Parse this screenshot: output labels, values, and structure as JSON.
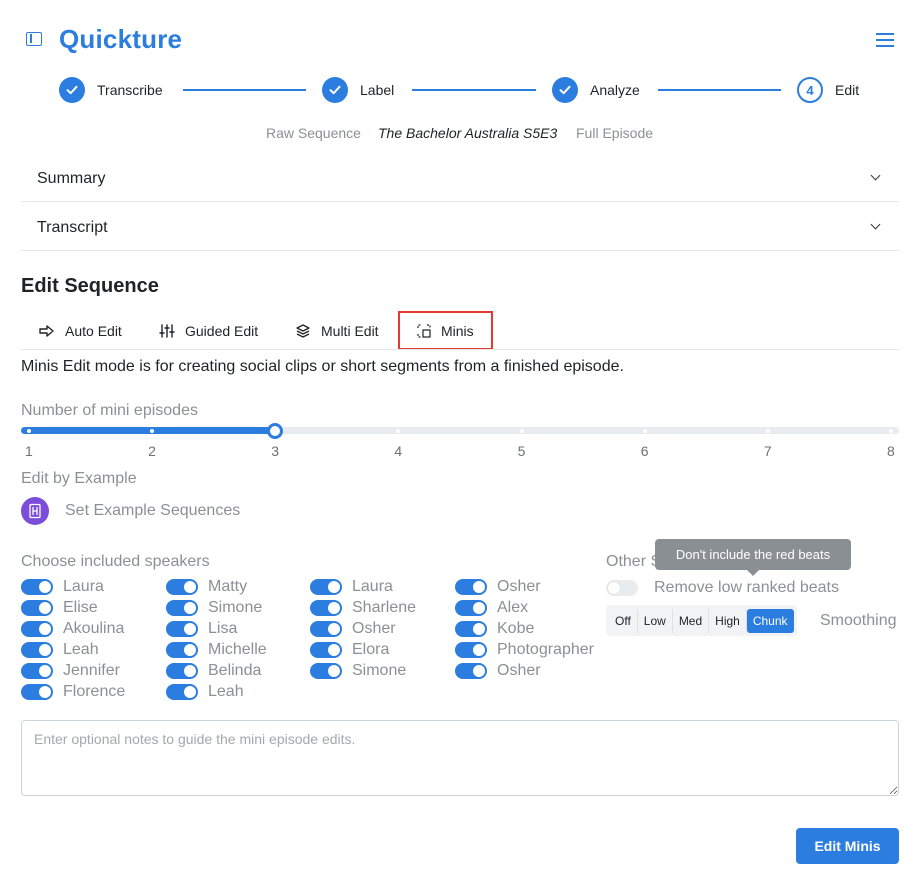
{
  "brand": "Quickture",
  "stepper": {
    "steps": [
      {
        "label": "Transcribe",
        "state": "done"
      },
      {
        "label": "Label",
        "state": "done"
      },
      {
        "label": "Analyze",
        "state": "done"
      },
      {
        "label": "Edit",
        "state": "current",
        "number": "4"
      }
    ]
  },
  "sequence_meta": {
    "type": "Raw Sequence",
    "name": "The Bachelor Australia S5E3",
    "scope": "Full Episode"
  },
  "accordion": {
    "summary": "Summary",
    "transcript": "Transcript"
  },
  "edit_sequence": {
    "title": "Edit Sequence",
    "tabs": [
      {
        "label": "Auto Edit",
        "icon": "arrow-right-icon"
      },
      {
        "label": "Guided Edit",
        "icon": "sliders-icon"
      },
      {
        "label": "Multi Edit",
        "icon": "layers-icon"
      },
      {
        "label": "Minis",
        "icon": "crop-icon",
        "active": true
      }
    ],
    "description": "Minis Edit mode is for creating social clips or short segments from a finished episode."
  },
  "mini_slider": {
    "label": "Number of mini episodes",
    "min": 1,
    "max": 8,
    "value": 3,
    "ticks": [
      "1",
      "2",
      "3",
      "4",
      "5",
      "6",
      "7",
      "8"
    ]
  },
  "edit_by_example": {
    "label": "Edit by Example",
    "button": "Set Example Sequences"
  },
  "speakers": {
    "label": "Choose included speakers",
    "columns": [
      [
        "Laura",
        "Elise",
        "Akoulina",
        "Leah",
        "Jennifer",
        "Florence"
      ],
      [
        "Matty",
        "Simone",
        "Lisa",
        "Michelle",
        "Belinda",
        "Leah"
      ],
      [
        "Laura",
        "Sharlene",
        "Osher",
        "Elora",
        "Simone"
      ],
      [
        "Osher",
        "Alex",
        "Kobe",
        "Photographer",
        "Osher"
      ]
    ]
  },
  "other_settings": {
    "label_visible": "Other S",
    "tooltip": "Don't include the red beats",
    "remove_low_ranked": "Remove low ranked beats",
    "smoothing_label": "Smoothing",
    "smoothing_options": [
      "Off",
      "Low",
      "Med",
      "High",
      "Chunk"
    ],
    "smoothing_selected": "Chunk"
  },
  "notes": {
    "placeholder": "Enter optional notes to guide the mini episode edits."
  },
  "actions": {
    "edit_minis": "Edit Minis"
  },
  "colors": {
    "accent": "#2b7de0",
    "highlight": "#e53b2f",
    "example_icon": "#7c4ddb"
  }
}
